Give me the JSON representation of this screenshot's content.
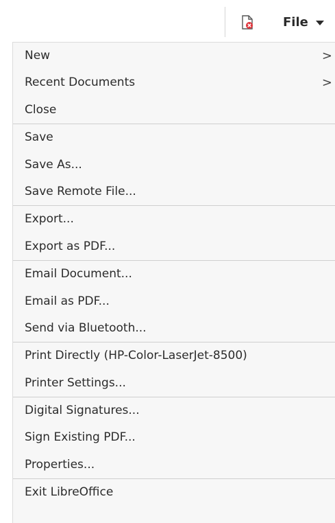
{
  "header": {
    "file_label": "File",
    "doc_icon": "document-error-icon",
    "caret_icon": "caret-down-icon"
  },
  "menu": {
    "groups": [
      [
        {
          "label": "New",
          "submenu": true
        },
        {
          "label": "Recent Documents",
          "submenu": true
        },
        {
          "label": "Close",
          "submenu": false
        }
      ],
      [
        {
          "label": "Save",
          "submenu": false
        },
        {
          "label": "Save As...",
          "submenu": false
        },
        {
          "label": "Save Remote File...",
          "submenu": false
        }
      ],
      [
        {
          "label": "Export...",
          "submenu": false
        },
        {
          "label": "Export as PDF...",
          "submenu": false
        }
      ],
      [
        {
          "label": "Email Document...",
          "submenu": false
        },
        {
          "label": "Email as PDF...",
          "submenu": false
        },
        {
          "label": "Send via Bluetooth...",
          "submenu": false
        }
      ],
      [
        {
          "label": "Print Directly (HP-Color-LaserJet-8500)",
          "submenu": false
        },
        {
          "label": "Printer Settings...",
          "submenu": false
        }
      ],
      [
        {
          "label": "Digital Signatures...",
          "submenu": false
        },
        {
          "label": "Sign Existing PDF...",
          "submenu": false
        },
        {
          "label": "Properties...",
          "submenu": false
        }
      ],
      [
        {
          "label": "Exit LibreOffice",
          "submenu": false
        }
      ]
    ],
    "submenu_glyph": ">"
  },
  "colors": {
    "text": "#2b2b2b",
    "menu_bg": "#f7f7f7",
    "separator": "#cfcfcf",
    "icon_red": "#e0343b"
  }
}
